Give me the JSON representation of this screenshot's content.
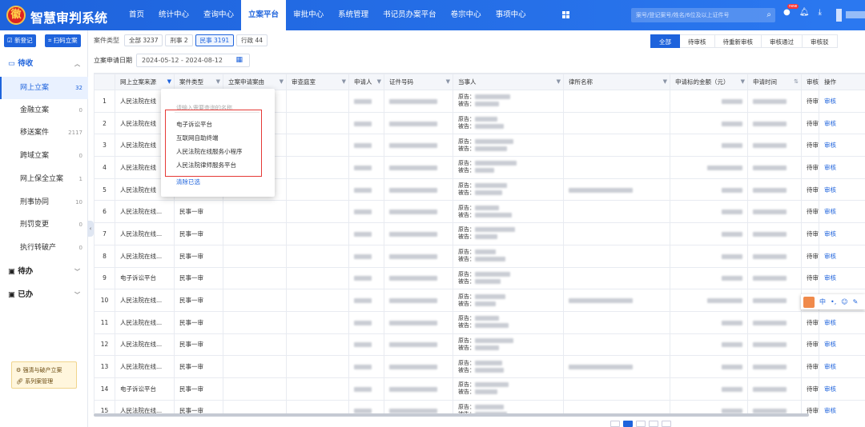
{
  "app": {
    "title": "智慧审判系统",
    "logo_glyph": "徽"
  },
  "nav": {
    "items": [
      "首页",
      "统计中心",
      "查询中心",
      "立案平台",
      "审批中心",
      "系统管理",
      "书记员办案平台",
      "卷宗中心",
      "事项中心"
    ],
    "active_index": 3
  },
  "header": {
    "search_placeholder": "案号/登记案号/姓名/6位及以上证件号",
    "new_badge": "new"
  },
  "sidebar": {
    "buttons": [
      "新登记",
      "扫码立案"
    ],
    "group_pending_receive": "待收",
    "items": [
      {
        "label": "网上立案",
        "count": "32"
      },
      {
        "label": "金融立案",
        "count": "0"
      },
      {
        "label": "移送案件",
        "count": "2117"
      },
      {
        "label": "跨域立案",
        "count": "0"
      },
      {
        "label": "网上保全立案",
        "count": "1"
      },
      {
        "label": "刑事协同",
        "count": "10"
      },
      {
        "label": "刑罚变更",
        "count": "0"
      },
      {
        "label": "执行转破产",
        "count": "0"
      }
    ],
    "group_todo": "待办",
    "group_done": "已办",
    "promo_line1": "强清与破产立案",
    "promo_line2": "系列案管理"
  },
  "filters": {
    "case_type_label": "案件类型",
    "case_type_chips": [
      "全部 3237",
      "刑事 2",
      "民事 3191",
      "行政 44"
    ],
    "active_chip": 2,
    "date_label": "立案申请日期",
    "date_range": "2024-05-12 - 2024-08-12"
  },
  "status_tabs": {
    "items": [
      "全部",
      "待审核",
      "待重新审核",
      "审核通过",
      "审核驳"
    ],
    "active_index": 0
  },
  "table": {
    "columns": [
      "",
      "网上立案来源",
      "案件类型",
      "立案申请案由",
      "审查庭室",
      "申请人",
      "证件号码",
      "当事人",
      "律所名称",
      "申请标的金额（元）",
      "申请时间",
      "审核",
      "操作"
    ],
    "rows": [
      {
        "no": "1",
        "source": "人民法院在线",
        "type": "",
        "status": "待审",
        "op": "审核",
        "plaintiff": "原告：",
        "defendant": "被告："
      },
      {
        "no": "2",
        "source": "人民法院在线",
        "type": "",
        "status": "待审",
        "op": "审核",
        "plaintiff": "原告：",
        "defendant": "被告："
      },
      {
        "no": "3",
        "source": "人民法院在线",
        "type": "",
        "status": "待审",
        "op": "审核",
        "plaintiff": "原告：",
        "defendant": "被告："
      },
      {
        "no": "4",
        "source": "人民法院在线",
        "type": "",
        "status": "待审",
        "op": "审核",
        "plaintiff": "原告：",
        "defendant": "被告："
      },
      {
        "no": "5",
        "source": "人民法院在线",
        "type": "",
        "status": "待审",
        "op": "审核",
        "plaintiff": "原告：",
        "defendant": "被告："
      },
      {
        "no": "6",
        "source": "人民法院在线...",
        "type": "民事一审",
        "status": "待审",
        "op": "审核",
        "plaintiff": "原告：",
        "defendant": "被告："
      },
      {
        "no": "7",
        "source": "人民法院在线...",
        "type": "民事一审",
        "status": "待审",
        "op": "审核",
        "plaintiff": "原告：",
        "defendant": "被告："
      },
      {
        "no": "8",
        "source": "人民法院在线...",
        "type": "民事一审",
        "status": "待审",
        "op": "审核",
        "plaintiff": "原告：",
        "defendant": "被告："
      },
      {
        "no": "9",
        "source": "电子诉讼平台",
        "type": "民事一审",
        "status": "待审",
        "op": "审核",
        "plaintiff": "原告：",
        "defendant": "被告："
      },
      {
        "no": "10",
        "source": "人民法院在线...",
        "type": "民事一审",
        "status": "待审",
        "op": "审核",
        "plaintiff": "原告：",
        "defendant": "被告："
      },
      {
        "no": "11",
        "source": "人民法院在线...",
        "type": "民事一审",
        "status": "待审",
        "op": "审核",
        "plaintiff": "原告：",
        "defendant": "被告："
      },
      {
        "no": "12",
        "source": "人民法院在线...",
        "type": "民事一审",
        "status": "待审",
        "op": "审核",
        "plaintiff": "原告：",
        "defendant": "被告："
      },
      {
        "no": "13",
        "source": "人民法院在线...",
        "type": "民事一审",
        "status": "待审",
        "op": "审核",
        "plaintiff": "原告：",
        "defendant": "被告："
      },
      {
        "no": "14",
        "source": "电子诉讼平台",
        "type": "民事一审",
        "status": "待审",
        "op": "审核",
        "plaintiff": "原告：",
        "defendant": "被告："
      },
      {
        "no": "15",
        "source": "人民法院在线...",
        "type": "民事一审",
        "status": "待审",
        "op": "审核",
        "plaintiff": "原告：",
        "defendant": "被告："
      }
    ]
  },
  "source_filter_dropdown": {
    "search_placeholder": "请输入需要查询的名称",
    "options": [
      "电子诉讼平台",
      "互联网自助终端",
      "人民法院在线服务小程序",
      "人民法院律师服务平台"
    ],
    "clear_label": "清除已选"
  },
  "ime_toolbar": {
    "label": "中"
  },
  "colors": {
    "brand": "#1e63dc",
    "highlight_box": "#e53935"
  }
}
